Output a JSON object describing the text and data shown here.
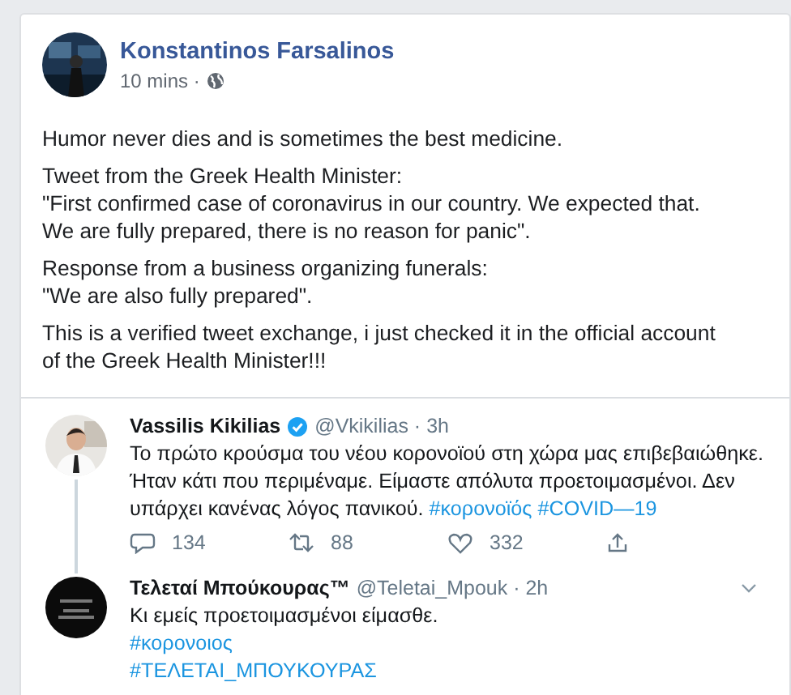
{
  "post": {
    "author": "Konstantinos Farsalinos",
    "time": "10 mins ·",
    "paragraphs": [
      [
        "Humor never dies and is sometimes the best medicine."
      ],
      [
        "Tweet from the Greek Health Minister:",
        "\"First confirmed case of coronavirus in our country. We expected that.",
        "We are fully prepared, there is no reason for panic\"."
      ],
      [
        "Response from a business organizing funerals:",
        "\"We are also fully prepared\"."
      ],
      [
        "This is a verified tweet exchange, i just checked it in the official account",
        "of the Greek Health Minister!!!"
      ]
    ]
  },
  "tweets": [
    {
      "name": "Vassilis Kikilias",
      "verified": true,
      "handle": "@Vkikilias · 3h",
      "lines": [
        "Το πρώτο κρούσμα του νέου κορονοϊού στη χώρα μας επιβεβαιώθηκε.",
        "Ήταν κάτι που περιμέναμε. Είμαστε απόλυτα προετοιμασμένοι. Δεν",
        "υπάρχει κανένας λόγος πανικού. *#κορονοϊός #COVID—19*"
      ],
      "actions": {
        "replies": "134",
        "retweets": "88",
        "likes": "332"
      }
    },
    {
      "name": "Τελεταί Μπούκουρας™",
      "handle": "@Teletai_Mpouk · 2h",
      "chevron": true,
      "lines": [
        "Κι εμείς προετοιμασμένοι είμασθε.",
        "*#κορονοιος*",
        "*#ΤΕΛΕΤΑΙ_ΜΠΟΥΚΟΥΡΑΣ*"
      ]
    }
  ]
}
